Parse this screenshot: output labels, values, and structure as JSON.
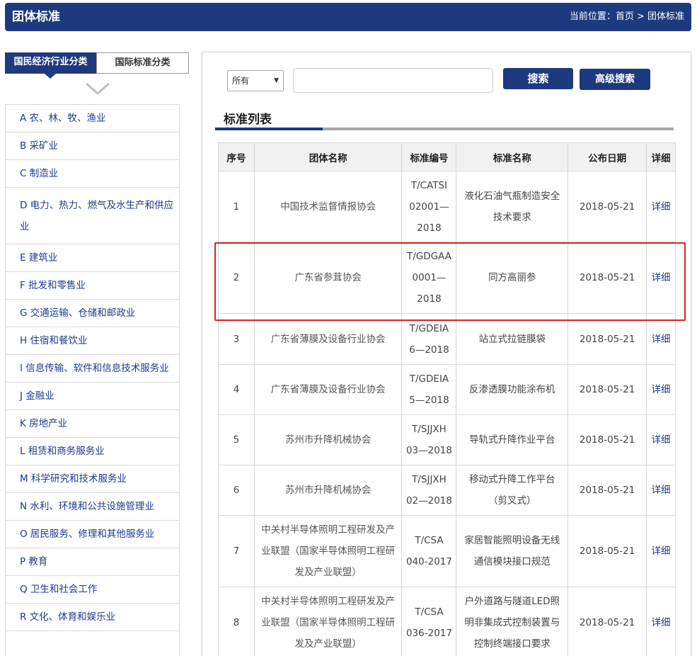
{
  "header": {
    "title": "团体标准",
    "breadcrumb": "当前位置：首页 > 团体标准"
  },
  "category_tabs": [
    {
      "label": "国民经济行业分类",
      "active": true
    },
    {
      "label": "国际标准分类",
      "active": false
    }
  ],
  "sidebar": {
    "items": [
      {
        "label": "A 农、林、牧、渔业"
      },
      {
        "label": "B 采矿业"
      },
      {
        "label": "C 制造业"
      },
      {
        "label": "D 电力、热力、燃气及水生产和供应业"
      },
      {
        "label": "E 建筑业"
      },
      {
        "label": "F 批发和零售业"
      },
      {
        "label": "G 交通运输、仓储和邮政业"
      },
      {
        "label": "H 住宿和餐饮业"
      },
      {
        "label": "I 信息传输、软件和信息技术服务业"
      },
      {
        "label": "J 金融业"
      },
      {
        "label": "K 房地产业"
      },
      {
        "label": "L 租赁和商务服务业"
      },
      {
        "label": "M 科学研究和技术服务业"
      },
      {
        "label": "N 水利、环境和公共设施管理业"
      },
      {
        "label": "O 居民服务、修理和其他服务业"
      },
      {
        "label": "P 教育"
      },
      {
        "label": "Q 卫生和社会工作"
      },
      {
        "label": "R 文化、体育和娱乐业"
      }
    ]
  },
  "search": {
    "select_value": "所有",
    "input_value": "",
    "search_label": "搜索",
    "advanced_label": "高级搜索"
  },
  "list": {
    "title": "标准列表",
    "headers": [
      "序号",
      "团体名称",
      "标准编号",
      "标准名称",
      "公布日期",
      "详细"
    ],
    "rows": [
      {
        "no": "1",
        "org": "中国技术监督情报协会",
        "code": [
          "T/CATSI",
          "02001—",
          "2018"
        ],
        "name": [
          "液化石油气瓶制造安全",
          "技术要求"
        ],
        "date": "2018-05-21",
        "detail": "详细"
      },
      {
        "no": "2",
        "org": "广东省参茸协会",
        "code": [
          "T/GDGAA",
          "0001—",
          "2018"
        ],
        "name": [
          "同方高丽参"
        ],
        "date": "2018-05-21",
        "detail": "详细"
      },
      {
        "no": "3",
        "org": "广东省薄膜及设备行业协会",
        "code": [
          "T/GDEIA",
          "6—2018"
        ],
        "name": [
          "站立式拉链膜袋"
        ],
        "date": "2018-05-21",
        "detail": "详细"
      },
      {
        "no": "4",
        "org": "广东省薄膜及设备行业协会",
        "code": [
          "T/GDEIA",
          "5—2018"
        ],
        "name": [
          "反渗透膜功能涂布机"
        ],
        "date": "2018-05-21",
        "detail": "详细"
      },
      {
        "no": "5",
        "org": "苏州市升降机械协会",
        "code": [
          "T/SJJXH",
          "03—2018"
        ],
        "name": [
          "导轨式升降作业平台"
        ],
        "date": "2018-05-21",
        "detail": "详细"
      },
      {
        "no": "6",
        "org": "苏州市升降机械协会",
        "code": [
          "T/SJJXH",
          "02—2018"
        ],
        "name": [
          "移动式升降工作平台",
          "（剪叉式）"
        ],
        "date": "2018-05-21",
        "detail": "详细"
      },
      {
        "no": "7",
        "org": [
          "中关村半导体照明工程研发及产",
          "业联盟（国家半导体照明工程研",
          "发及产业联盟）"
        ],
        "code": [
          "T/CSA",
          "040-2017"
        ],
        "name": [
          "家居智能照明设备无线",
          "通信模块接口规范"
        ],
        "date": "2018-05-21",
        "detail": "详细"
      },
      {
        "no": "8",
        "org": [
          "中关村半导体照明工程研发及产",
          "业联盟（国家半导体照明工程研",
          "发及产业联盟）"
        ],
        "code": [
          "T/CSA",
          "036-2017"
        ],
        "name": [
          "户外道路与隧道LED照",
          "明非集成式控制装置与",
          "控制终端接口要求"
        ],
        "date": "2018-05-21",
        "detail": "详细"
      }
    ]
  },
  "colors": {
    "brand": "#1e3a7e",
    "link": "#1e3a8e",
    "highlight": "#e02020"
  }
}
